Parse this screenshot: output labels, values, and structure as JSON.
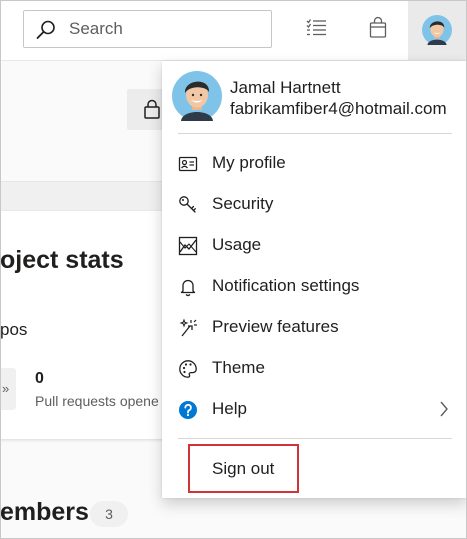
{
  "topbar": {
    "search": {
      "placeholder": "Search",
      "value": ""
    }
  },
  "background": {
    "card_title": "oject stats",
    "repos_label": "pos",
    "stat_icon_glyph": "»",
    "pull_requests": {
      "count": "0",
      "label": "Pull requests opene"
    },
    "members": {
      "title": "embers",
      "count": "3"
    }
  },
  "user": {
    "name": "Jamal Hartnett",
    "email": "fabrikamfiber4@hotmail.com"
  },
  "menu": {
    "items": [
      {
        "label": "My profile",
        "icon": "profile-card-icon"
      },
      {
        "label": "Security",
        "icon": "key-icon"
      },
      {
        "label": "Usage",
        "icon": "usage-chart-icon"
      },
      {
        "label": "Notification settings",
        "icon": "bell-icon"
      },
      {
        "label": "Preview features",
        "icon": "preview-sparkle-icon"
      },
      {
        "label": "Theme",
        "icon": "palette-icon"
      },
      {
        "label": "Help",
        "icon": "help-icon"
      }
    ],
    "sign_out": "Sign out"
  },
  "colors": {
    "accent": "#0078d4",
    "highlight_box": "#d13438",
    "avatar_bg": "#7fc4e8",
    "hair": "#2b2b2b",
    "skin": "#f2c7a5"
  }
}
